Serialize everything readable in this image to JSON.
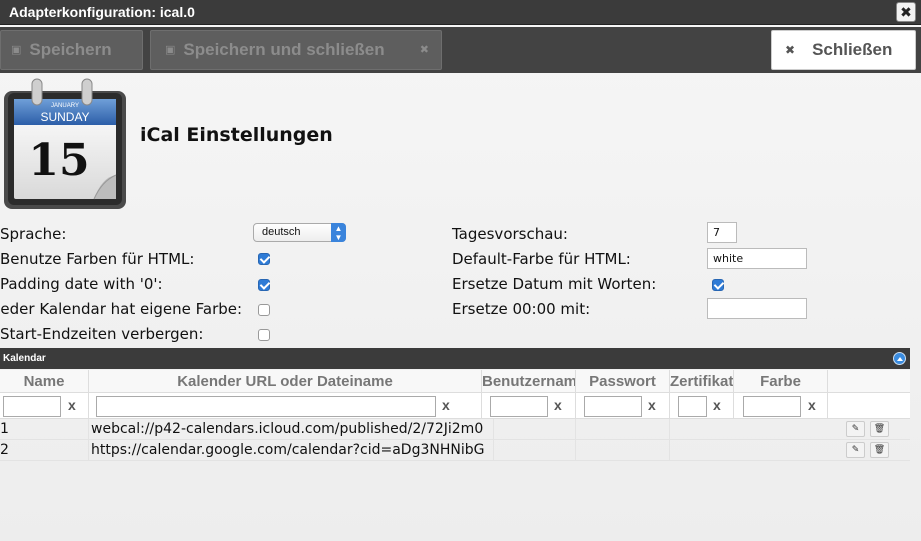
{
  "window": {
    "title": "Adapterkonfiguration: ical.0",
    "close_glyph": "✖"
  },
  "toolbar": {
    "save_label": "Speichern",
    "save_close_label": "Speichern und schließen",
    "close_label": "Schließen",
    "save_icon": "save-icon",
    "close_icon": "close-icon"
  },
  "logo": {
    "month": "JANUARY",
    "weekday": "SUNDAY",
    "day": "15"
  },
  "heading": "iCal Einstellungen",
  "settings": {
    "sprache_label": "Sprache:",
    "sprache_value": "deutsch",
    "benutze_farben_label": "Benutze Farben für HTML:",
    "benutze_farben_checked": true,
    "padding_label": "Padding date with '0':",
    "padding_checked": true,
    "jeder_kalendar_label": "Jeder Kalendar hat eigene Farbe:",
    "jeder_kalendar_checked": false,
    "start_end_label": "Start-Endzeiten verbergen:",
    "start_end_checked": false,
    "tagesvorschau_label": "Tagesvorschau:",
    "tagesvorschau_value": "7",
    "default_farbe_label": "Default-Farbe für HTML:",
    "default_farbe_value": "white",
    "ersetze_datum_label": "Ersetze Datum mit Worten:",
    "ersetze_datum_checked": true,
    "ersetze_0000_label": "Ersetze 00:00 mit:",
    "ersetze_0000_value": ""
  },
  "kalendar": {
    "title": "Kalendar",
    "columns": [
      "Name",
      "Kalender URL oder Dateiname",
      "Benutzername",
      "Passwort",
      "Zertifikat",
      "Farbe"
    ],
    "filter_clear": "x",
    "rows": [
      {
        "name": "1",
        "url": "webcal://p42-calendars.icloud.com/published/2/72Ji2m0"
      },
      {
        "name": "2",
        "url": "https://calendar.google.com/calendar?cid=aDg3NHNibG"
      }
    ],
    "edit_glyph": "✎",
    "delete_glyph": "🗑"
  },
  "colors": {
    "titlebar": "#3b3b3b",
    "toolbar": "#434343",
    "checkbox_accent": "#2e7bd6",
    "select_arrow": "#3a84dc"
  }
}
